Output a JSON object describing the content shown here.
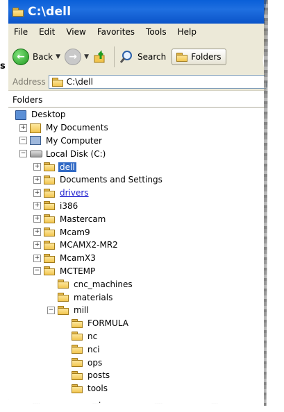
{
  "window": {
    "title": "C:\\dell"
  },
  "menu": [
    "File",
    "Edit",
    "View",
    "Favorites",
    "Tools",
    "Help"
  ],
  "toolbar": {
    "back_label": "Back",
    "search_label": "Search",
    "folders_label": "Folders"
  },
  "address": {
    "label": "Address",
    "value": "C:\\dell"
  },
  "folders_pane": {
    "title": "Folders"
  },
  "tree": [
    {
      "label": "Desktop",
      "level": 0,
      "expander": "none",
      "icon": "desktop-icon"
    },
    {
      "label": "My Documents",
      "level": 1,
      "expander": "+",
      "icon": "my-documents-icon"
    },
    {
      "label": "My Computer",
      "level": 1,
      "expander": "-",
      "icon": "my-computer-icon"
    },
    {
      "label": "Local Disk (C:)",
      "level": 2,
      "expander": "-",
      "icon": "local-disk-icon"
    },
    {
      "label": "dell",
      "level": 3,
      "expander": "+",
      "icon": "folder-icon",
      "selected": true
    },
    {
      "label": "Documents and Settings",
      "level": 3,
      "expander": "+",
      "icon": "folder-icon"
    },
    {
      "label": "drivers",
      "level": 3,
      "expander": "+",
      "icon": "folder-icon",
      "link": true
    },
    {
      "label": "i386",
      "level": 3,
      "expander": "+",
      "icon": "folder-icon"
    },
    {
      "label": "Mastercam",
      "level": 3,
      "expander": "+",
      "icon": "folder-icon"
    },
    {
      "label": "Mcam9",
      "level": 3,
      "expander": "+",
      "icon": "folder-icon"
    },
    {
      "label": "MCAMX2-MR2",
      "level": 3,
      "expander": "+",
      "icon": "folder-icon"
    },
    {
      "label": "McamX3",
      "level": 3,
      "expander": "+",
      "icon": "folder-icon"
    },
    {
      "label": "MCTEMP",
      "level": 3,
      "expander": "-",
      "icon": "folder-icon"
    },
    {
      "label": "cnc_machines",
      "level": 4,
      "expander": "none",
      "icon": "folder-icon"
    },
    {
      "label": "materials",
      "level": 4,
      "expander": "none",
      "icon": "folder-icon"
    },
    {
      "label": "mill",
      "level": 4,
      "expander": "-",
      "icon": "folder-icon"
    },
    {
      "label": "FORMULA",
      "level": 5,
      "expander": "none",
      "icon": "folder-icon"
    },
    {
      "label": "nc",
      "level": 5,
      "expander": "none",
      "icon": "folder-icon"
    },
    {
      "label": "nci",
      "level": 5,
      "expander": "none",
      "icon": "folder-icon"
    },
    {
      "label": "ops",
      "level": 5,
      "expander": "none",
      "icon": "folder-icon"
    },
    {
      "label": "posts",
      "level": 5,
      "expander": "none",
      "icon": "folder-icon"
    },
    {
      "label": "tools",
      "level": 5,
      "expander": "none",
      "icon": "folder-icon"
    }
  ],
  "partial_text": "loads",
  "side_fragment": "s"
}
